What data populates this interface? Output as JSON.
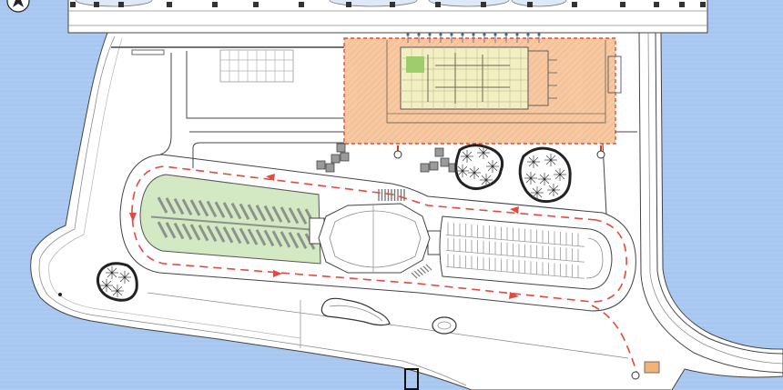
{
  "colors": {
    "water": "#a7c7f0",
    "water_ripple": "#b9d4f5",
    "land": "#ffffff",
    "project_zone": "#f7c9a2",
    "project_zone_hatch": "#eeb387",
    "project_zone_border": "#e0503a",
    "building": "#f2efc3",
    "building_grid": "#c9c394",
    "garden": "#9fcd6c",
    "green_parking": "#d3e9c3",
    "parking_stall": "#8e928c",
    "route": "#e04a3f",
    "tree_cluster_outline": "#222222",
    "block": "#9a9a9a",
    "gate": "#f2b278"
  },
  "icons": {
    "north_arrow": "north-arrow-icon",
    "tree": "tree-icon",
    "entrance_marker": "entrance-marker-icon",
    "route_arrow": "route-arrow-icon"
  }
}
